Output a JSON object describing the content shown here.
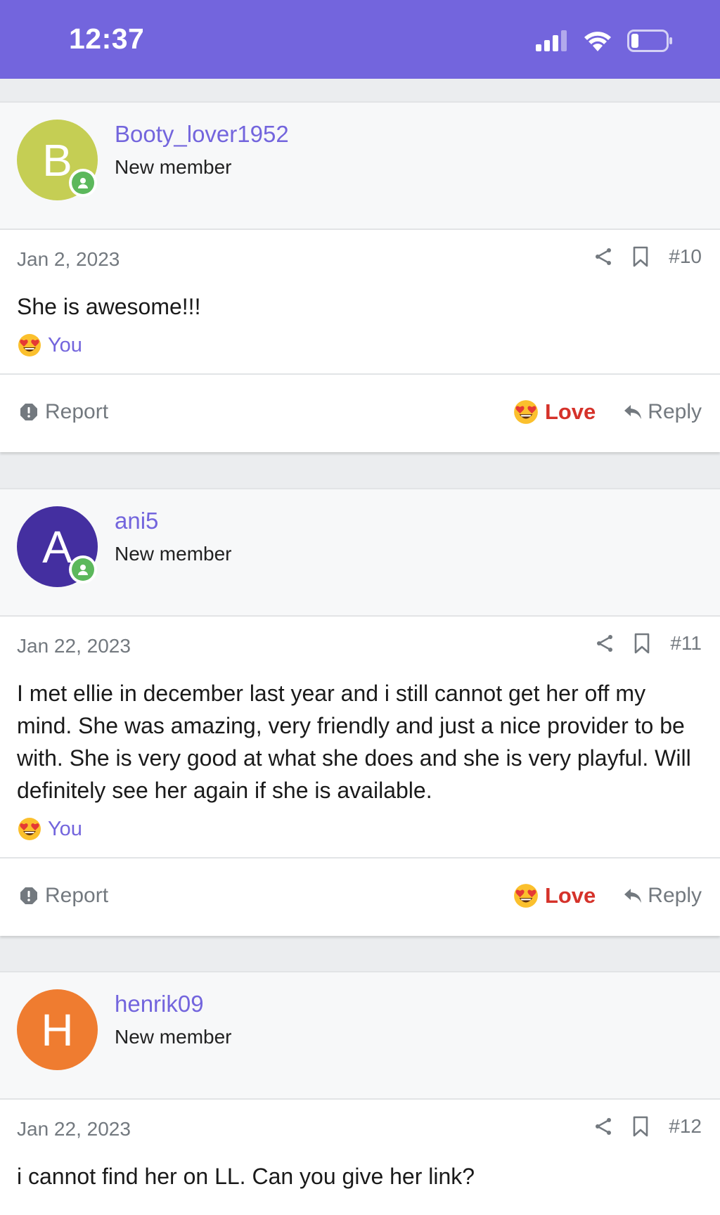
{
  "status_bar": {
    "time": "12:37"
  },
  "posts": [
    {
      "avatar_letter": "B",
      "avatar_color": "#c5ce54",
      "username": "Booty_lover1952",
      "user_title": "New member",
      "date": "Jan 2, 2023",
      "number": "#10",
      "body": "She is awesome!!!",
      "reaction_label": "You",
      "report_label": "Report",
      "love_label": "Love",
      "reply_label": "Reply"
    },
    {
      "avatar_letter": "A",
      "avatar_color": "#442fa0",
      "username": "ani5",
      "user_title": "New member",
      "date": "Jan 22, 2023",
      "number": "#11",
      "body": "I met ellie in december last year and i still cannot get her off my mind. She was amazing, very friendly and just a nice provider to be with. She is very good at what she does and she is very playful. Will definitely see her again if she is available.",
      "reaction_label": "You",
      "report_label": "Report",
      "love_label": "Love",
      "reply_label": "Reply"
    },
    {
      "avatar_letter": "H",
      "avatar_color": "#ef7c30",
      "username": "henrik09",
      "user_title": "New member",
      "date": "Jan 22, 2023",
      "number": "#12",
      "body": "i cannot find her on LL. Can you give her link?"
    }
  ],
  "colors": {
    "accent": "#7365dd",
    "love_red": "#d5322a",
    "online_green": "#5cb85c"
  }
}
